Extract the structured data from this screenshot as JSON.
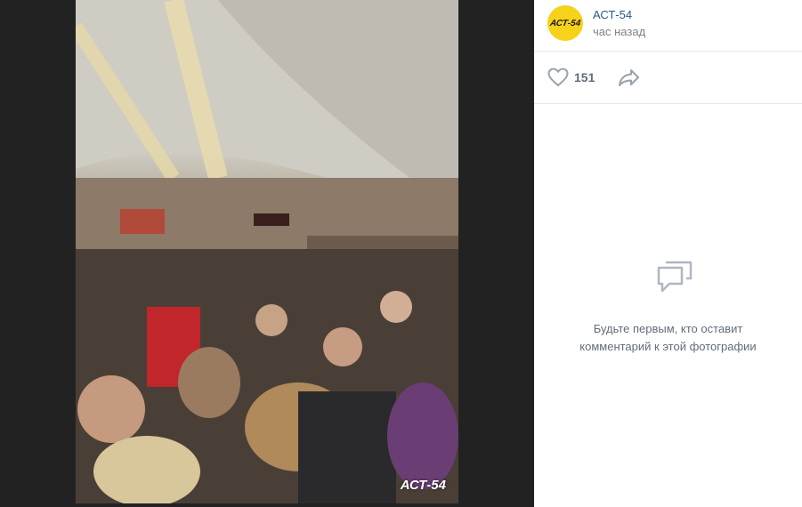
{
  "post": {
    "author": "АСТ-54",
    "avatar_text": "АСТ-54",
    "time": "час назад"
  },
  "photo": {
    "watermark": "АСТ-54",
    "icon": "photo-crowd-metro-platform"
  },
  "actions": {
    "like_count": "151",
    "like_icon": "heart-icon",
    "share_icon": "share-arrow-icon"
  },
  "comments": {
    "empty_line1": "Будьте первым, кто оставит",
    "empty_line2": "комментарий к этой фотографии",
    "icon": "comment-bubble-icon"
  },
  "colors": {
    "link": "#2a5885",
    "muted": "#828282",
    "icon": "#aeb7c2",
    "avatar_bg": "#f6d21a",
    "viewer_bg": "#222222"
  }
}
